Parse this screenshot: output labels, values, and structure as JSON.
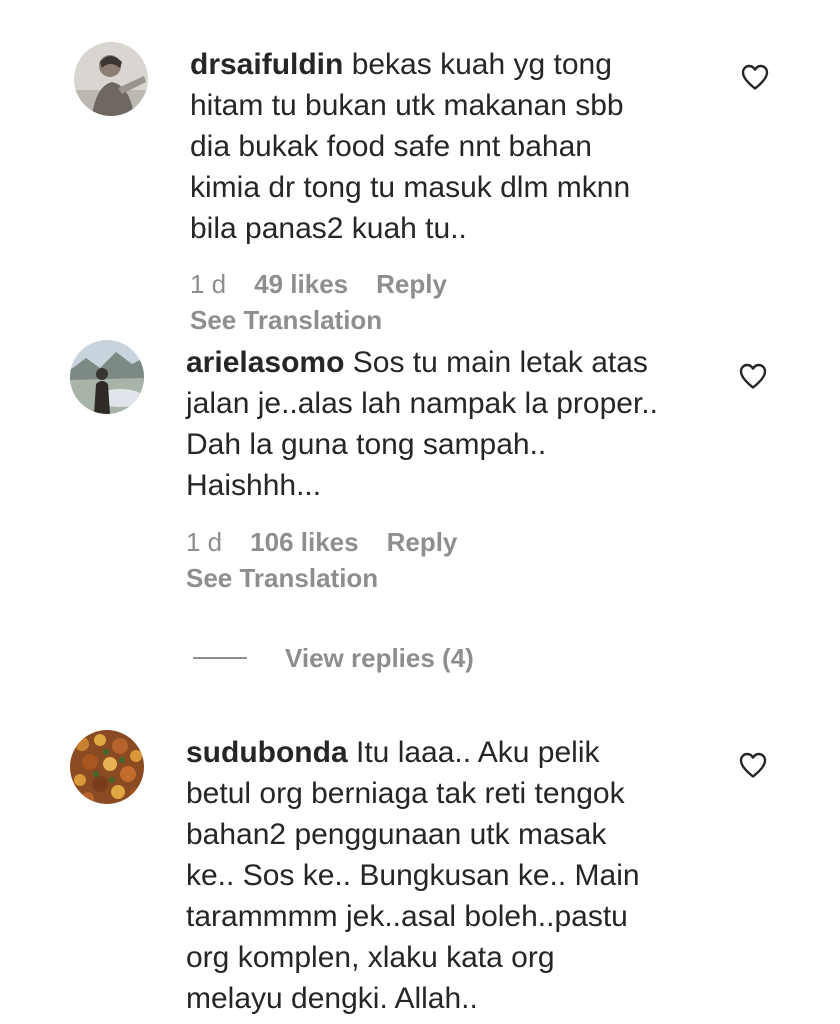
{
  "comments": [
    {
      "username": "drsaifuldin",
      "text": "bekas kuah yg tong\nhitam tu bukan utk makanan sbb\ndia bukak food safe nnt bahan\nkimia dr tong tu masuk dlm mknn\nbila panas2 kuah tu..",
      "time": "1 d",
      "likes": "49 likes",
      "reply": "Reply",
      "translation": "See Translation",
      "avatar_icon": "person-photo-avatar",
      "like_icon": "heart-outline-icon"
    },
    {
      "username": "arielasomo",
      "text": "Sos tu main letak atas\njalan je..alas lah nampak la proper..\nDah la guna tong sampah..\nHaishhh...",
      "time": "1 d",
      "likes": "106 likes",
      "reply": "Reply",
      "translation": "See Translation",
      "avatar_icon": "landscape-photo-avatar",
      "like_icon": "heart-outline-icon"
    },
    {
      "username": "sudubonda",
      "text": "Itu laaa.. Aku pelik\nbetul org berniaga tak reti tengok\nbahan2 penggunaan utk masak\nke.. Sos ke.. Bungkusan ke.. Main\ntarammmm jek..asal boleh..pastu\norg komplen, xlaku kata org\nmelayu dengki. Allah..",
      "avatar_icon": "food-pattern-avatar",
      "like_icon": "heart-outline-icon"
    }
  ],
  "view_replies": {
    "label": "View replies (4)"
  },
  "colors": {
    "text": "#262626",
    "secondary": "#8e8e8e",
    "background": "#ffffff"
  }
}
